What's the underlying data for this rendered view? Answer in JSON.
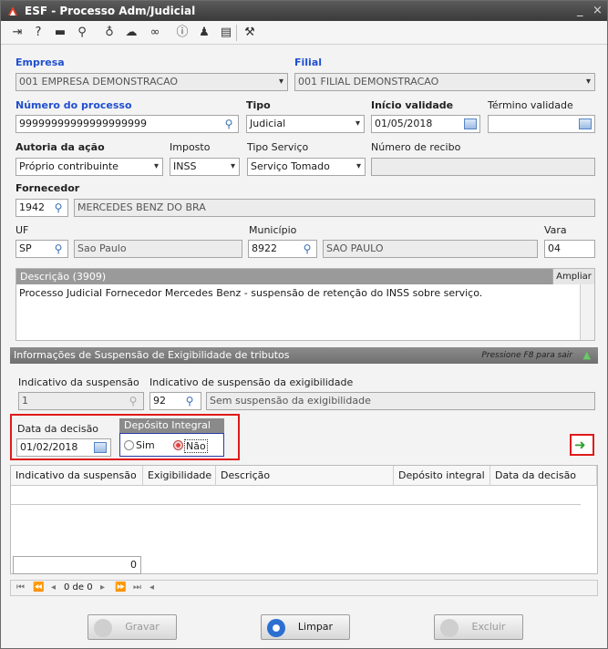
{
  "window": {
    "title": "ESF - Processo Adm/Judicial",
    "controls": [
      "_",
      "×"
    ]
  },
  "toolbar": {
    "icons": [
      "exit-icon",
      "help-icon",
      "keyboard-icon",
      "search-icon",
      "lightbulb-icon",
      "brain-icon",
      "link-icon",
      "info-icon",
      "user-icon",
      "document-icon",
      "tools-icon"
    ]
  },
  "form": {
    "empresa": {
      "label": "Empresa",
      "value": "001 EMPRESA DEMONSTRACAO"
    },
    "filial": {
      "label": "Filial",
      "value": "001 FILIAL DEMONSTRACAO"
    },
    "numero_processo": {
      "label": "Número do processo",
      "value": "99999999999999999999"
    },
    "tipo": {
      "label": "Tipo",
      "value": "Judicial"
    },
    "inicio_validade": {
      "label": "Início validade",
      "value": "01/05/2018"
    },
    "termino_validade": {
      "label": "Término validade",
      "value": ""
    },
    "autoria": {
      "label": "Autoria da ação",
      "value": "Próprio contribuinte"
    },
    "imposto": {
      "label": "Imposto",
      "value": "INSS"
    },
    "tipo_servico": {
      "label": "Tipo Serviço",
      "value": "Serviço Tomado"
    },
    "numero_recibo": {
      "label": "Número de recibo",
      "value": ""
    },
    "fornecedor": {
      "label": "Fornecedor",
      "code": "1942",
      "name": "MERCEDES BENZ DO BRA"
    },
    "uf": {
      "label": "UF",
      "code": "SP",
      "name": "Sao Paulo"
    },
    "municipio": {
      "label": "Município",
      "code": "8922",
      "name": "SAO PAULO"
    },
    "vara": {
      "label": "Vara",
      "value": "04"
    },
    "descricao": {
      "label": "Descrição (3909)",
      "expand": "Ampliar",
      "text": "Processo Judicial Fornecedor Mercedes Benz - suspensão de retenção do INSS sobre serviço."
    }
  },
  "suspensao": {
    "header": "Informações de Suspensão de Exigibilidade de tributos",
    "hint": "Pressione F8 para sair",
    "indicativo_label": "Indicativo da suspensão",
    "indicativo_value": "1",
    "exig_label": "Indicativo de suspensão da exigibilidade",
    "exig_code": "92",
    "exig_desc": "Sem suspensão da exigibilidade",
    "data_decisao_label": "Data da decisão",
    "data_decisao_value": "01/02/2018",
    "deposito_label": "Depósito Integral",
    "opt_sim": "Sim",
    "opt_nao": "Não",
    "selected": "Não"
  },
  "grid": {
    "columns": [
      "Indicativo da suspensão",
      "Exigibilidade",
      "Descrição",
      "Depósito integral",
      "Data da decisão"
    ],
    "footer_value": "0",
    "nav_text": "0 de 0"
  },
  "buttons": {
    "gravar": "Gravar",
    "limpar": "Limpar",
    "excluir": "Excluir"
  }
}
